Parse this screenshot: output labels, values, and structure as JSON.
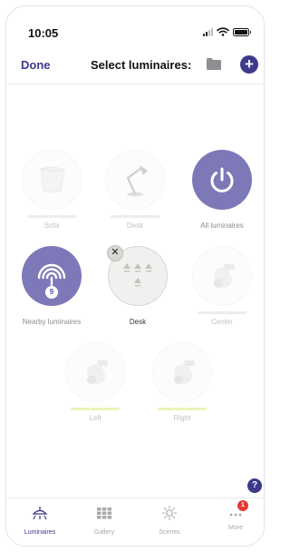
{
  "status": {
    "time": "10:05"
  },
  "nav": {
    "done_label": "Done",
    "title": "Select luminaires:"
  },
  "icons": {
    "folder": "folder-icon",
    "add": "plus-icon",
    "help": "question-icon",
    "remove": "close-icon",
    "power": "power-icon",
    "nearby": "signal-waves-icon",
    "lamp": "lamp-icon",
    "spot": "spotlight-icon",
    "group": "lamp-group-icon"
  },
  "tiles": {
    "sofa": {
      "label": "Sofa"
    },
    "desk_unselected": {
      "label": "Desk"
    },
    "all_luminaires": {
      "label": "All luminaires"
    },
    "nearby_luminaires": {
      "label": "Nearby luminaires",
      "count": "9"
    },
    "desk_selected": {
      "label": "Desk",
      "remove_symbol": "✕"
    },
    "center": {
      "label": "Center"
    },
    "left": {
      "label": "Left"
    },
    "right": {
      "label": "Right"
    }
  },
  "help": {
    "symbol": "?"
  },
  "tabs": [
    {
      "label": "Luminaires",
      "active": true
    },
    {
      "label": "Gallery",
      "active": false
    },
    {
      "label": "Scenes",
      "active": false
    },
    {
      "label": "More",
      "active": false,
      "badge": "1"
    }
  ],
  "colors": {
    "accent": "#3d3a8c",
    "tile_purple": "#7d79b8",
    "badge_red": "#e53935",
    "dim_bar_yellow": "#eef3b9"
  }
}
